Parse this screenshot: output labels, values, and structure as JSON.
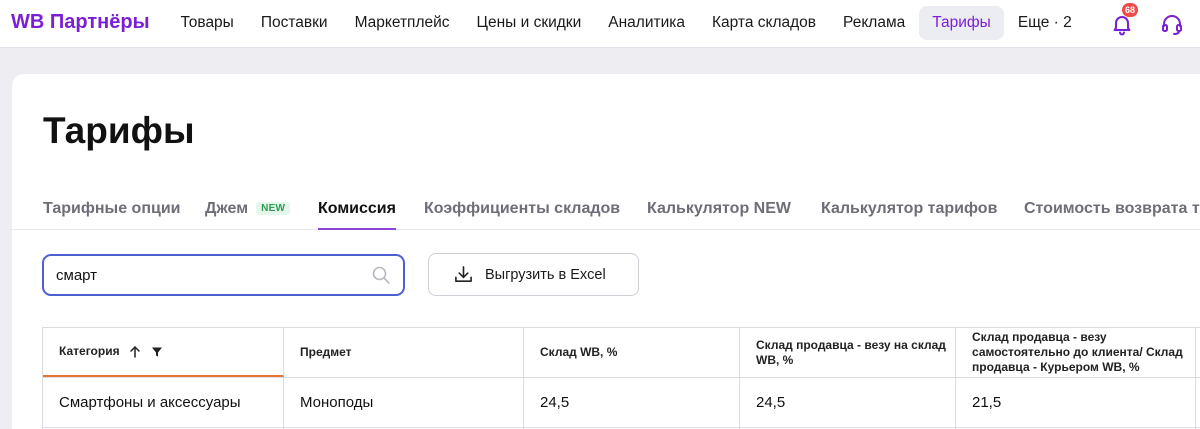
{
  "brand": "WB Партнёры",
  "nav": [
    {
      "label": "Товары",
      "active": false
    },
    {
      "label": "Поставки",
      "active": false
    },
    {
      "label": "Маркетплейс",
      "active": false
    },
    {
      "label": "Цены и скидки",
      "active": false
    },
    {
      "label": "Аналитика",
      "active": false
    },
    {
      "label": "Карта складов",
      "active": false
    },
    {
      "label": "Реклама",
      "active": false
    },
    {
      "label": "Тарифы",
      "active": true
    },
    {
      "label": "Еще · 2",
      "active": false
    }
  ],
  "notifications": {
    "count": "68",
    "icon": "bell-icon"
  },
  "support_icon": "headset-icon",
  "page": {
    "title": "Тарифы"
  },
  "tabs": [
    {
      "label": "Тарифные опции",
      "active": false
    },
    {
      "label": "Джем",
      "tag": "NEW",
      "active": false
    },
    {
      "label": "Комиссия",
      "active": true
    },
    {
      "label": "Коэффициенты складов",
      "active": false
    },
    {
      "label": "Калькулятор NEW",
      "active": false
    },
    {
      "label": "Калькулятор тарифов",
      "active": false
    },
    {
      "label": "Стоимость возврата т",
      "active": false
    }
  ],
  "search": {
    "value": "смарт",
    "icon": "search-icon"
  },
  "export_button": {
    "label": "Выгрузить в Excel",
    "icon": "download-icon"
  },
  "table": {
    "columns": [
      "Категория",
      "Предмет",
      "Склад WB, %",
      "Склад продавца - везу на склад WB, %",
      "Склад продавца - везу самостоятельно до клиента/ Склад продавца - Курьером WB, %"
    ],
    "rows": [
      [
        "Смартфоны и аксессуары",
        "Моноподы",
        "24,5",
        "24,5",
        "21,5"
      ]
    ]
  },
  "colors": {
    "brand": "#7b1fd6",
    "search_border": "#4d5fd1",
    "tab_underline": "#8a46d6",
    "sort_underline": "#e8743b",
    "badge": "#f04b4b"
  }
}
